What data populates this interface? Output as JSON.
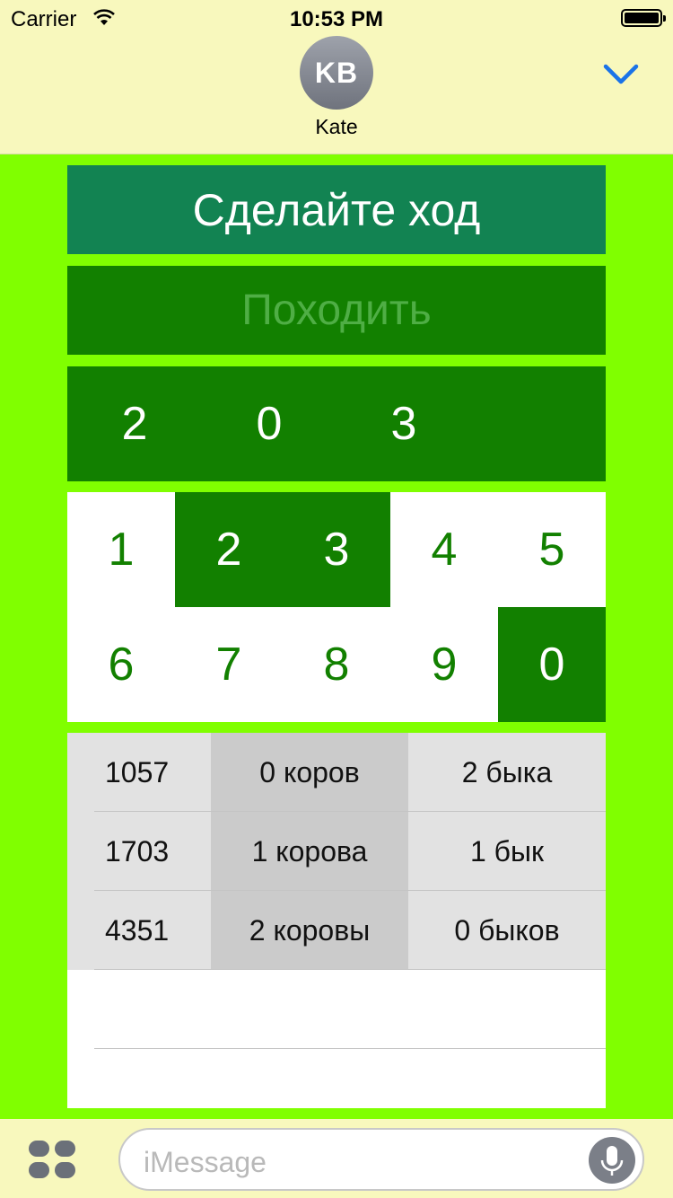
{
  "status_bar": {
    "carrier": "Carrier",
    "time": "10:53 PM"
  },
  "header": {
    "avatar_initials": "KB",
    "contact_name": "Kate",
    "collapse_icon": "chevron-down-icon"
  },
  "game": {
    "prompt": "Сделайте ход",
    "submit_label": "Походить",
    "current_guess": [
      "2",
      "0",
      "3",
      ""
    ],
    "keypad": [
      {
        "label": "1",
        "used": false
      },
      {
        "label": "2",
        "used": true
      },
      {
        "label": "3",
        "used": true
      },
      {
        "label": "4",
        "used": false
      },
      {
        "label": "5",
        "used": false
      },
      {
        "label": "6",
        "used": false
      },
      {
        "label": "7",
        "used": false
      },
      {
        "label": "8",
        "used": false
      },
      {
        "label": "9",
        "used": false
      },
      {
        "label": "0",
        "used": true
      }
    ],
    "history": [
      {
        "number": "1057",
        "cows": "0 коров",
        "bulls": "2 быка"
      },
      {
        "number": "1703",
        "cows": "1 корова",
        "bulls": "1 бык"
      },
      {
        "number": "4351",
        "cows": "2 коровы",
        "bulls": "0 быков"
      }
    ]
  },
  "compose": {
    "placeholder": "iMessage",
    "apps_icon": "app-drawer-icon",
    "mic_icon": "microphone-icon"
  },
  "colors": {
    "header_bg": "#f8f8bd",
    "game_bg": "#80ff00",
    "dark_green": "#128000",
    "prompt_bg": "#128352",
    "accent_blue": "#1a73e8"
  }
}
